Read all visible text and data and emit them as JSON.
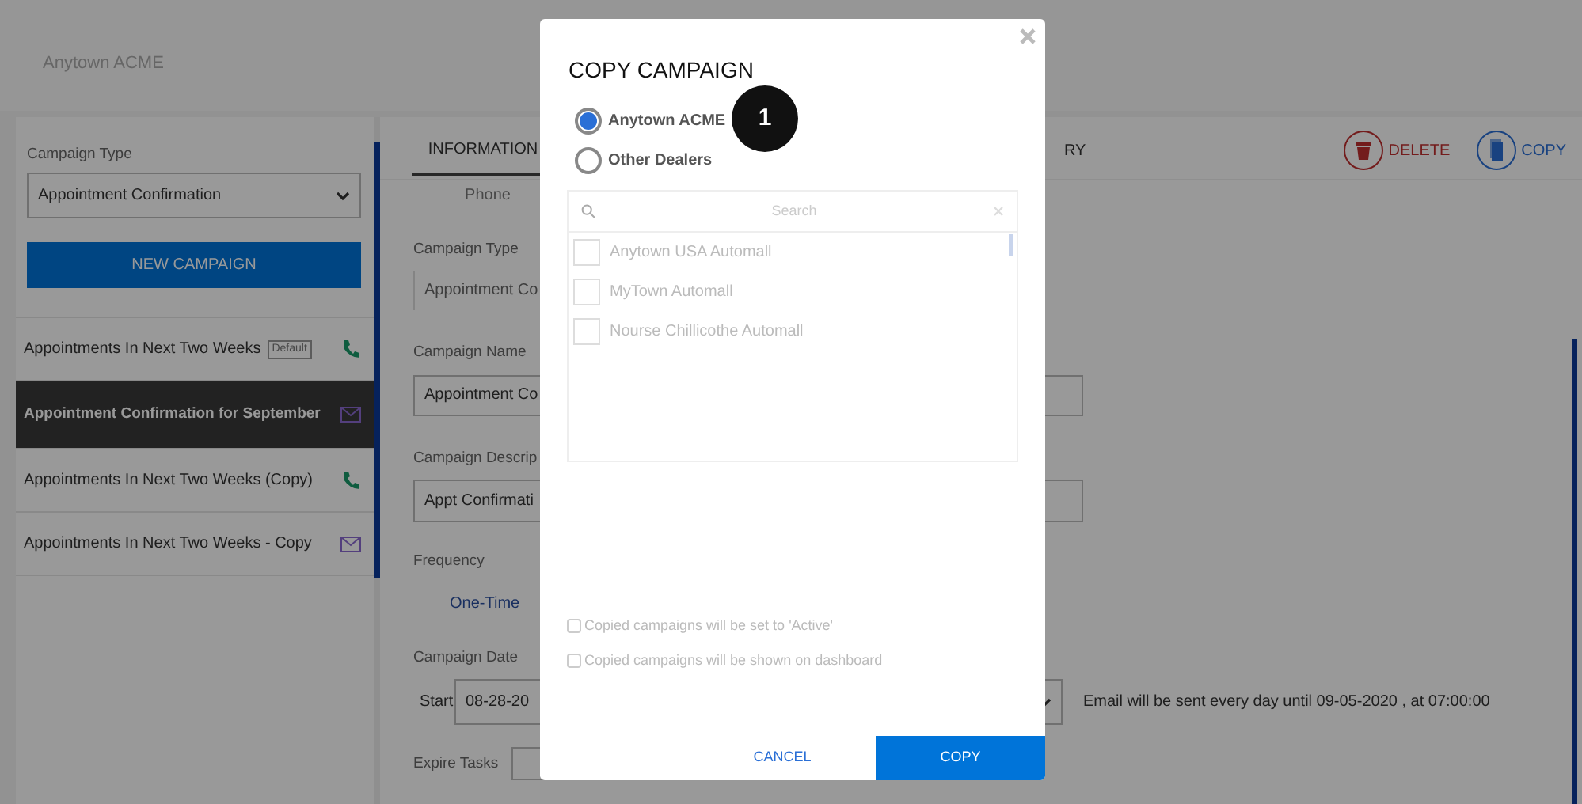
{
  "header": {
    "title": "Anytown ACME"
  },
  "sidebar": {
    "type_label": "Campaign Type",
    "type_value": "Appointment Confirmation",
    "new_button": "NEW CAMPAIGN",
    "campaigns": [
      {
        "name": "Appointments In Next Two Weeks",
        "badge": "Default",
        "kind": "phone",
        "selected": false
      },
      {
        "name": "Appointment Confirmation for September",
        "kind": "email",
        "selected": true
      },
      {
        "name": "Appointments In Next Two Weeks (Copy)",
        "kind": "phone",
        "selected": false
      },
      {
        "name": "Appointments In Next Two Weeks - Copy",
        "kind": "email",
        "selected": false
      }
    ]
  },
  "tabs": [
    {
      "label": "INFORMATION",
      "sub": "Phone",
      "selected": true
    },
    {
      "label": "RY",
      "selected": false
    }
  ],
  "actions": [
    {
      "label": "DELETE",
      "kind": "delete"
    },
    {
      "label": "COPY",
      "kind": "copy"
    }
  ],
  "form": {
    "type_label": "Campaign Type",
    "type_value": "Appointment Co",
    "name_label": "Campaign Name",
    "name_value": "Appointment Co",
    "desc_label": "Campaign Descrip",
    "desc_value": "Appt Confirmati",
    "frequency_label": "Frequency",
    "frequency_value": "One-Time",
    "date_label": "Campaign Date",
    "start_label": "Start",
    "start_value": "08-28-20",
    "schedule_note": "Email will be sent every day until 09-05-2020 , at 07:00:00",
    "expire_label": "Expire Tasks"
  },
  "modal": {
    "title": "COPY CAMPAIGN",
    "targets": [
      {
        "label": "Anytown ACME",
        "selected": true
      },
      {
        "label": "Other Dealers",
        "selected": false
      }
    ],
    "callout": "1",
    "dealer_list": {
      "placeholder": "Search",
      "disabled": true,
      "dealers": [
        {
          "name": "Anytown USA Automall",
          "checked": false
        },
        {
          "name": "MyTown Automall",
          "checked": false
        },
        {
          "name": "Nourse Chillicothe Automall",
          "checked": false
        }
      ]
    },
    "options": [
      {
        "label": "Copied campaigns will be set to 'Active'",
        "checked": false,
        "disabled": true
      },
      {
        "label": "Copied campaigns will be shown on dashboard",
        "checked": false,
        "disabled": true
      }
    ],
    "cancel": "CANCEL",
    "confirm": "COPY"
  }
}
